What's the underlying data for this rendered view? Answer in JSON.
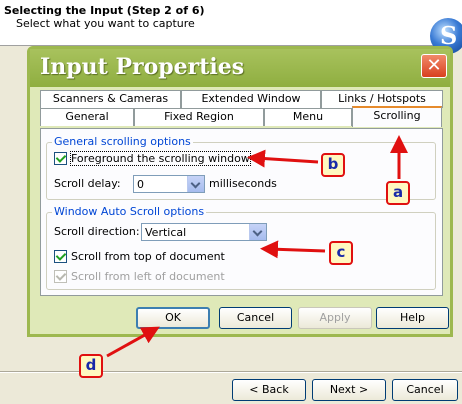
{
  "wizard": {
    "title": "Selecting the Input (Step 2 of 6)",
    "subtitle": "Select what you want to capture",
    "logo_letter": "S"
  },
  "dialog": {
    "title": "Input Properties",
    "close_glyph": "✕",
    "tabs_back": [
      "Scanners & Cameras",
      "Extended Window",
      "Links / Hotspots"
    ],
    "tabs_front": [
      "General",
      "Fixed Region",
      "Menu",
      "Scrolling"
    ],
    "active_tab": "Scrolling",
    "general_group": {
      "label": "General scrolling options",
      "foreground_checkbox": "Foreground the scrolling window",
      "foreground_checked": true,
      "scroll_delay_label": "Scroll delay:",
      "scroll_delay_value": "0",
      "scroll_delay_unit": "milliseconds"
    },
    "auto_group": {
      "label": "Window Auto Scroll options",
      "direction_label": "Scroll direction:",
      "direction_value": "Vertical",
      "from_top": "Scroll from top of document",
      "from_top_checked": true,
      "from_left": "Scroll from left of document",
      "from_left_checked": true,
      "from_left_disabled": true
    },
    "buttons": {
      "ok": "OK",
      "cancel": "Cancel",
      "apply": "Apply",
      "help": "Help"
    }
  },
  "wizard_buttons": {
    "back": "< Back",
    "next": "Next >",
    "cancel": "Cancel"
  },
  "annotations": [
    "a",
    "b",
    "c",
    "d"
  ],
  "colors": {
    "annotation_border": "#e01010",
    "annotation_fill": "#fff8c0",
    "dialog_title_bg": "#8fae40"
  }
}
